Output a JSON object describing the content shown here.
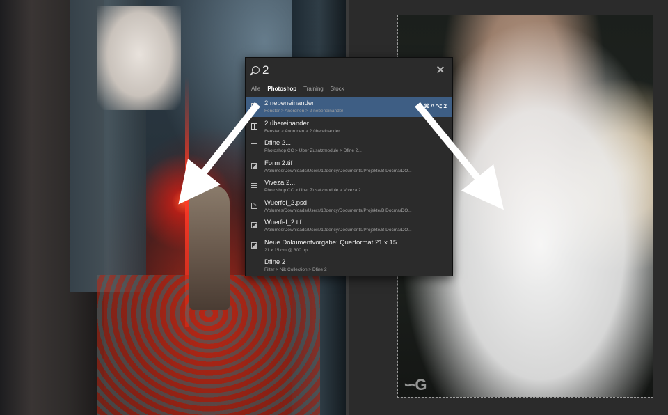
{
  "search": {
    "query": "2"
  },
  "tabs": [
    {
      "label": "Alle",
      "active": false
    },
    {
      "label": "Photoshop",
      "active": true
    },
    {
      "label": "Training",
      "active": false
    },
    {
      "label": "Stock",
      "active": false
    }
  ],
  "results": [
    {
      "title": "2 nebeneinander",
      "subtitle": "Fenster > Anordnen > 2 nebeneinander",
      "shortcut": "⌘ ^ ⌥ 2",
      "icon": "layout-icon",
      "selected": true
    },
    {
      "title": "2 übereinander",
      "subtitle": "Fenster > Anordnen > 2 übereinander",
      "shortcut": "",
      "icon": "layout-icon",
      "selected": false
    },
    {
      "title": "Dfine 2...",
      "subtitle": "Photoshop CC > Über Zusatzmodule > Dfine 2...",
      "shortcut": "",
      "icon": "menu-icon",
      "selected": false
    },
    {
      "title": "Form 2.tif",
      "subtitle": "/Volumes/Downloads/Users/10dency/Documents/Projekte/B Docma/DO...",
      "shortcut": "",
      "icon": "image-icon",
      "selected": false
    },
    {
      "title": "Viveza 2...",
      "subtitle": "Photoshop CC > Über Zusatzmodule > Viveza 2...",
      "shortcut": "",
      "icon": "menu-icon",
      "selected": false
    },
    {
      "title": "Wuerfel_2.psd",
      "subtitle": "/Volumes/Downloads/Users/10dency/Documents/Projekte/B Docma/DO...",
      "shortcut": "",
      "icon": "psd-icon",
      "selected": false
    },
    {
      "title": "Wuerfel_2.tif",
      "subtitle": "/Volumes/Downloads/Users/10dency/Documents/Projekte/B Docma/DO...",
      "shortcut": "",
      "icon": "image-icon",
      "selected": false
    },
    {
      "title": "Neue Dokumentvorgabe: Querformat 21 x 15",
      "subtitle": "21 x 15 cm @ 300 ppi",
      "shortcut": "",
      "icon": "image-icon",
      "selected": false
    },
    {
      "title": "Dfine 2",
      "subtitle": "Filter > Nik Collection > Dfine 2",
      "shortcut": "",
      "icon": "menu-icon",
      "selected": false
    }
  ],
  "colors": {
    "selection": "#3e5e84",
    "accent_underline": "#1473e6",
    "panel_bg": "#2b2b2b"
  }
}
